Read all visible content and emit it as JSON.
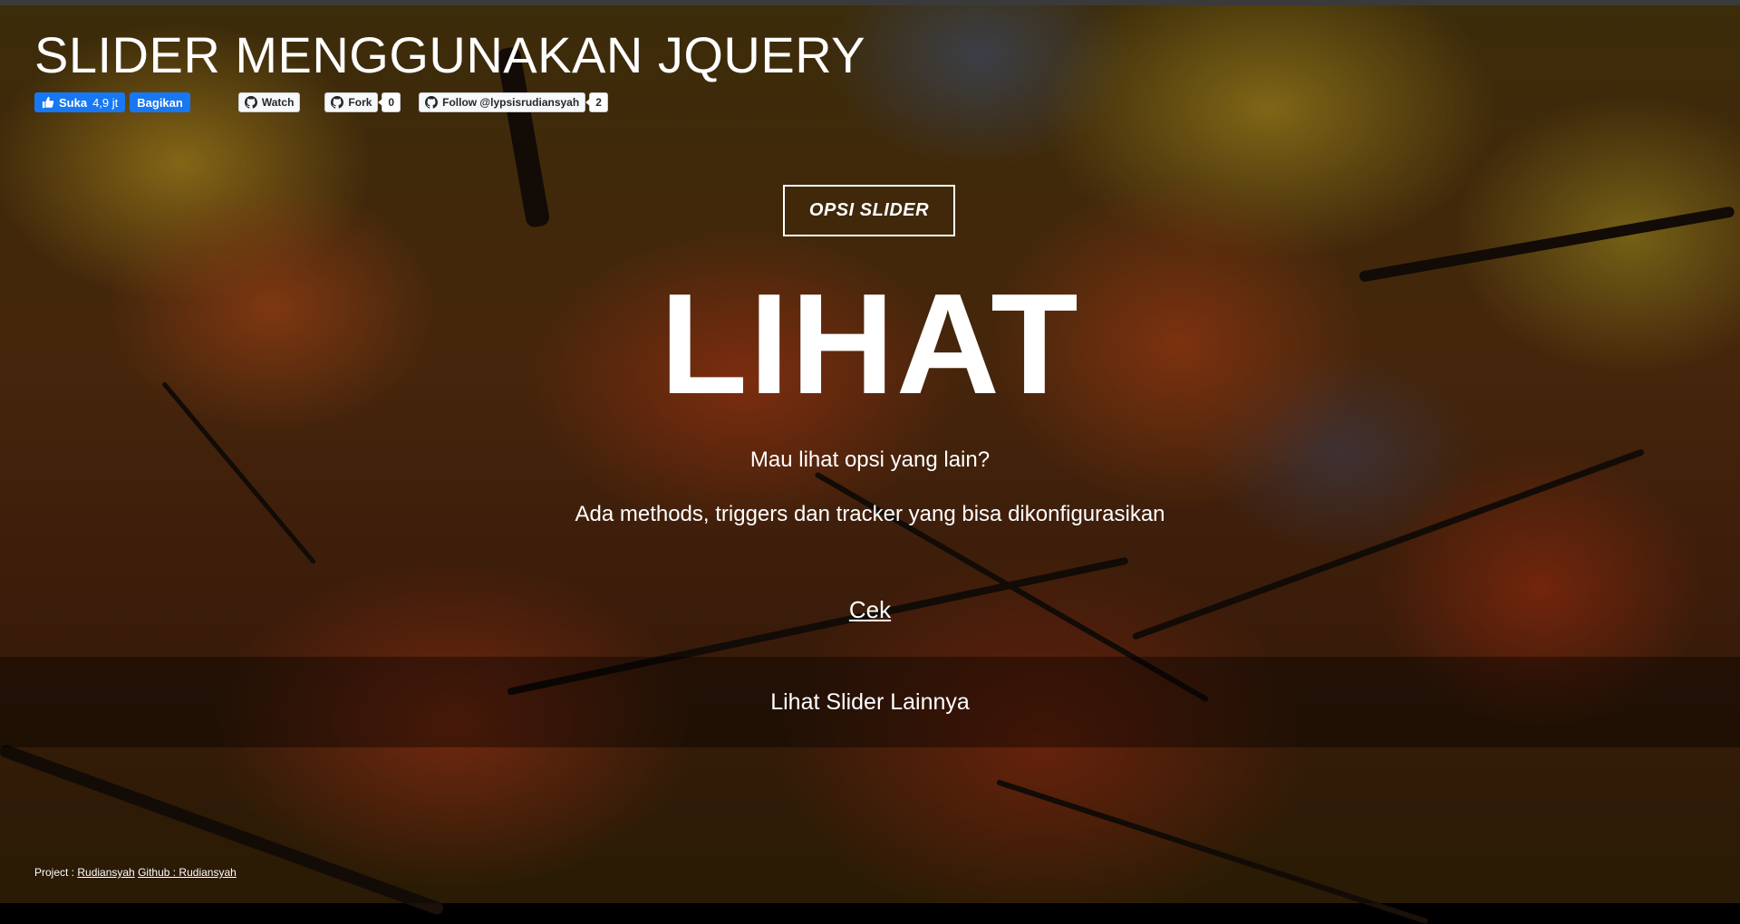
{
  "header": {
    "title": "SLIDER MENGGUNAKAN JQUERY"
  },
  "social": {
    "facebook_like_label": "Suka",
    "facebook_like_count": "4,9 jt",
    "facebook_share_label": "Bagikan",
    "github_watch_label": "Watch",
    "github_fork_label": "Fork",
    "github_fork_count": "0",
    "github_follow_label": "Follow @lypsisrudiansyah",
    "github_follow_count": "2"
  },
  "hero": {
    "option_button": "OPSI SLIDER",
    "headline": "LIHAT",
    "subtitle": "Mau lihat opsi yang lain?",
    "description": "Ada methods, triggers dan tracker yang bisa dikonfigurasikan",
    "check_link": "Cek"
  },
  "band": {
    "label": "Lihat Slider Lainnya"
  },
  "footer": {
    "project_label": "Project :",
    "project_link": "Rudiansyah",
    "github_link": "Github : Rudiansyah"
  },
  "colors": {
    "facebook_blue": "#1877f2",
    "github_button_bg": "#f6f8fa",
    "text": "#ffffff"
  },
  "icons": [
    "thumbs-up-icon",
    "github-icon"
  ]
}
